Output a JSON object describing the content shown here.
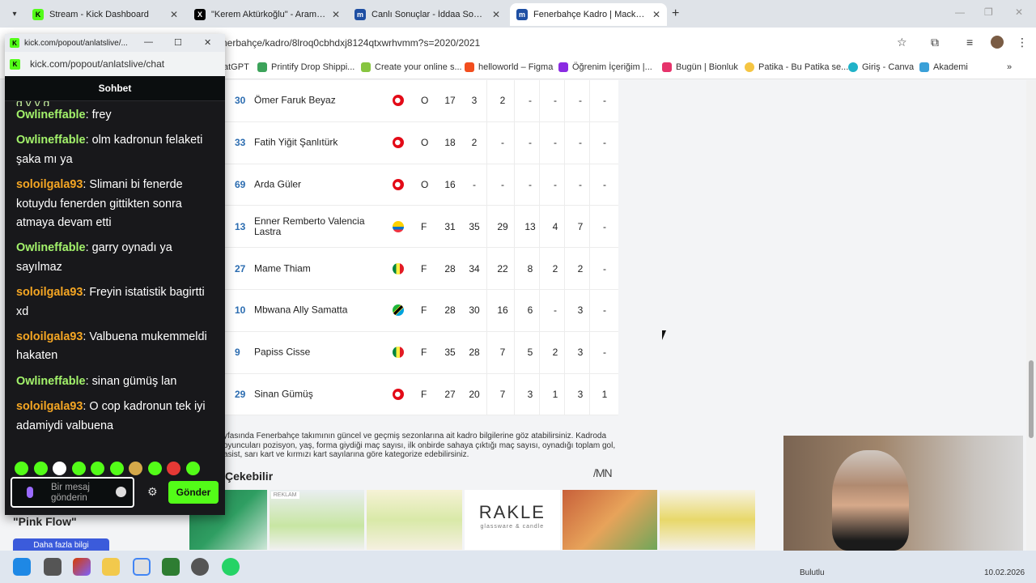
{
  "browser": {
    "tabs": [
      {
        "label": "Stream - Kick Dashboard",
        "favicon": "kick-icon",
        "active": false
      },
      {
        "label": "\"Kerem Aktürkoğlu\" - Arama / X",
        "favicon": "x-icon",
        "active": false
      },
      {
        "label": "Canlı Sonuçlar - İddaa Sonuçları",
        "favicon": "mackolik-icon",
        "active": false
      },
      {
        "label": "Fenerbahçe Kadro | Mackolik.com",
        "favicon": "mackolik-icon",
        "active": true
      }
    ],
    "address": "nerbahçe/kadro/8lroq0cbhdxj8124qtxwrhvmm?s=2020/2021",
    "bookmarks": [
      "atGPT",
      "Printify Drop Shippi...",
      "Create your online s...",
      "helloworld – Figma",
      "Öğrenim İçeriğim |...",
      "Bugün | Bionluk",
      "Patika - Bu Patika se...",
      "Giriş - Canva",
      "Akademi"
    ]
  },
  "chat": {
    "window_title": "kick.com/popout/anlatslive/...",
    "url": "kick.com/popout/anlatslive/chat",
    "header": "Sohbet",
    "partial_top": "g  y   y  g",
    "messages": [
      {
        "user": "Owlineffable",
        "text": "frey",
        "color": "#a3f26b"
      },
      {
        "user": "Owlineffable",
        "text": "olm kadronun felaketi şaka mı ya",
        "color": "#a3f26b"
      },
      {
        "user": "soloilgala93",
        "text": "Slimani bi fenerde kotuydu fenerden gittikten sonra atmaya devam etti",
        "color": "#f5a623"
      },
      {
        "user": "Owlineffable",
        "text": "garry oynadı ya sayılmaz",
        "color": "#a3f26b"
      },
      {
        "user": "soloilgala93",
        "text": "Freyin istatistik bagirtti xd",
        "color": "#f5a623"
      },
      {
        "user": "soloilgala93",
        "text": "Valbuena mukemmeldi hakaten",
        "color": "#f5a623"
      },
      {
        "user": "Owlineffable",
        "text": "sinan gümüş lan",
        "color": "#a3f26b"
      },
      {
        "user": "soloilgala93",
        "text": "O cop kadronun tek iyi adamiydi valbuena",
        "color": "#f5a623"
      }
    ],
    "input_placeholder": "Bir mesaj gönderin",
    "send_label": "Gönder"
  },
  "squad": {
    "rows": [
      {
        "num": "30",
        "name": "Ömer Faruk Beyaz",
        "flag": "turkey",
        "pos": "O",
        "vals": [
          "17",
          "3",
          "2",
          "-",
          "-",
          "-",
          "-"
        ]
      },
      {
        "num": "33",
        "name": "Fatih Yiğit Şanlıtürk",
        "flag": "turkey",
        "pos": "O",
        "vals": [
          "18",
          "2",
          "-",
          "-",
          "-",
          "-",
          "-"
        ]
      },
      {
        "num": "69",
        "name": "Arda Güler",
        "flag": "turkey",
        "pos": "O",
        "vals": [
          "16",
          "-",
          "-",
          "-",
          "-",
          "-",
          "-"
        ]
      },
      {
        "num": "13",
        "name": "Enner Remberto Valencia Lastra",
        "flag": "ecuador",
        "pos": "F",
        "vals": [
          "31",
          "35",
          "29",
          "13",
          "4",
          "7",
          "-"
        ]
      },
      {
        "num": "27",
        "name": "Mame Thiam",
        "flag": "senegal",
        "pos": "F",
        "vals": [
          "28",
          "34",
          "22",
          "8",
          "2",
          "2",
          "-"
        ]
      },
      {
        "num": "10",
        "name": "Mbwana Ally Samatta",
        "flag": "tanzania",
        "pos": "F",
        "vals": [
          "28",
          "30",
          "16",
          "6",
          "-",
          "3",
          "-"
        ]
      },
      {
        "num": "9",
        "name": "Papiss Cisse",
        "flag": "senegal",
        "pos": "F",
        "vals": [
          "35",
          "28",
          "7",
          "5",
          "2",
          "3",
          "-"
        ]
      },
      {
        "num": "29",
        "name": "Sinan Gümüş",
        "flag": "turkey",
        "pos": "F",
        "vals": [
          "27",
          "20",
          "7",
          "3",
          "1",
          "3",
          "1"
        ]
      }
    ],
    "description": "yfasında Fenerbahçe takımının güncel ve geçmiş sezonlarına ait kadro bilgilerine göz atabilirsiniz. Kadroda oyuncuları pozisyon, yaş, forma giydiği maç sayısı, ilk onbirde sahaya çıktığı maç sayısı, oynadığı toplam gol, asist, sarı kart ve kırmızı kart sayılarına göre kategorize edebilirsiniz."
  },
  "section_title": "Çekebilir",
  "ad_label": "REKLAM",
  "ad_brand": "RAKLE",
  "ad_brand_sub": "glassware & candle",
  "sidebar_extra": {
    "title": "\"Pink Flow\"",
    "button": "Daha fazla bilgi"
  },
  "taskbar": {
    "weather": "Bulutlu",
    "date": "10.02.2026"
  }
}
